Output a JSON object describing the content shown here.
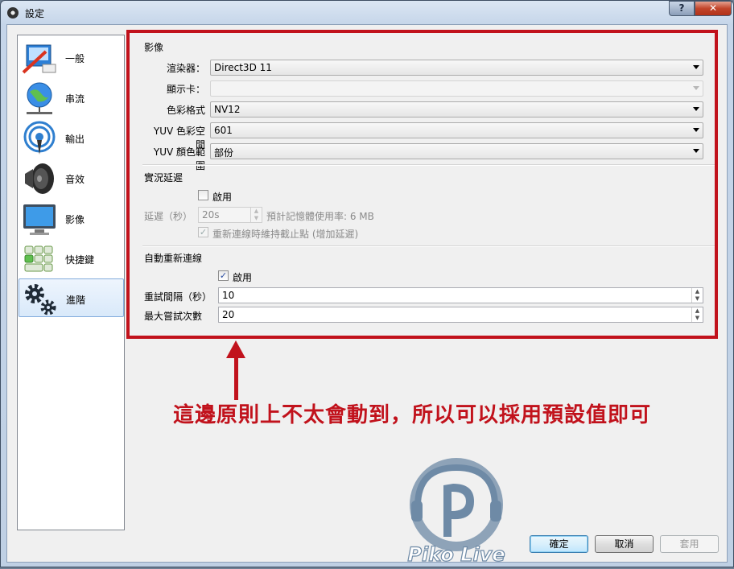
{
  "window": {
    "title": "設定",
    "help_label": "?",
    "close_label": "✕"
  },
  "sidebar": {
    "items": [
      {
        "label": "一般",
        "icon": "general-settings-icon"
      },
      {
        "label": "串流",
        "icon": "globe-network-icon"
      },
      {
        "label": "輸出",
        "icon": "broadcast-antenna-icon"
      },
      {
        "label": "音效",
        "icon": "speaker-icon"
      },
      {
        "label": "影像",
        "icon": "monitor-icon"
      },
      {
        "label": "快捷鍵",
        "icon": "keyboard-icon"
      },
      {
        "label": "進階",
        "icon": "gears-icon",
        "selected": true
      }
    ]
  },
  "video": {
    "section_title": "影像",
    "renderer_label": "渲染器：",
    "renderer_value": "Direct3D 11",
    "adapter_label": "顯示卡：",
    "adapter_value": "",
    "color_format_label": "色彩格式",
    "color_format_value": "NV12",
    "yuv_space_label": "YUV 色彩空間",
    "yuv_space_value": "601",
    "yuv_range_label": "YUV 顏色範圍",
    "yuv_range_value": "部份"
  },
  "stream_delay": {
    "section_title": "實況延遲",
    "enable_label": "啟用",
    "enabled": false,
    "delay_label": "延遲（秒）",
    "delay_value": "20s",
    "memory_label": "預計記憶體使用率: 6 MB",
    "preserve_label": "重新連線時維持截止點 (增加延遲)",
    "preserve_checked": true
  },
  "reconnect": {
    "section_title": "自動重新連線",
    "enable_label": "啟用",
    "enabled": true,
    "retry_delay_label": "重試間隔（秒）",
    "retry_delay_value": "10",
    "max_retries_label": "最大嘗試次數",
    "max_retries_value": "20"
  },
  "annotation": {
    "text": "這邊原則上不太會動到，所以可以採用預設值即可",
    "color": "#c1121c"
  },
  "watermark": {
    "text": "Piko Live"
  },
  "buttons": {
    "ok": "確定",
    "cancel": "取消",
    "apply": "套用"
  }
}
